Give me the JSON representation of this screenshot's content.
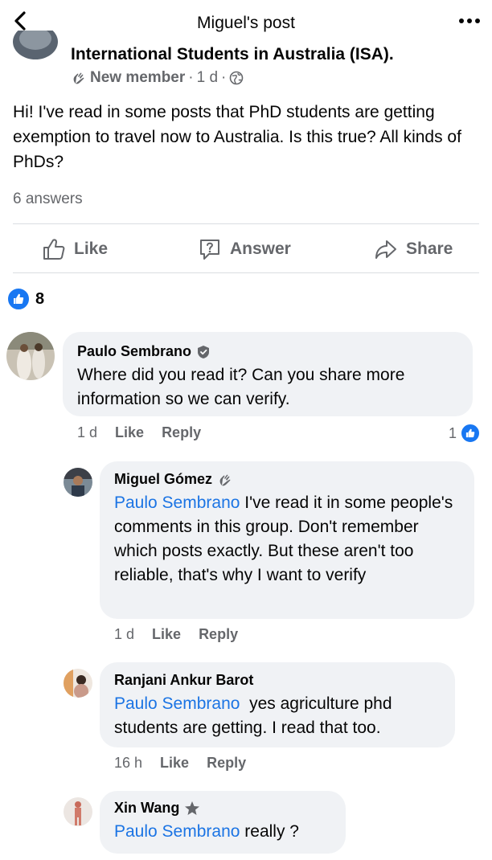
{
  "header": {
    "title": "Miguel's post"
  },
  "post": {
    "group_name": "International Students in Australia (ISA).",
    "member_badge": "New member",
    "time": "1 d",
    "separator": "·",
    "text": "Hi! I've read in some posts that PhD students are getting exemption to travel now to Australia. Is this true? All kinds of PhDs?",
    "answers_count": "6 answers",
    "actions": {
      "like": "Like",
      "answer": "Answer",
      "share": "Share"
    },
    "reaction_count": "8"
  },
  "comments": [
    {
      "author": "Paulo Sembrano",
      "text": "Where did you read it? Can you share more information so we can verify.",
      "time": "1 d",
      "like": "Like",
      "reply": "Reply",
      "reactions": "1"
    },
    {
      "author": "Miguel Gómez",
      "mention": "Paulo Sembrano",
      "text": "I've read it in some people's comments in this group. Don't remember which posts exactly. But these aren't too reliable, that's why I want to verify",
      "time": "1 d",
      "like": "Like",
      "reply": "Reply"
    },
    {
      "author": "Ranjani Ankur Barot",
      "mention": "Paulo Sembrano",
      "text": "yes agriculture phd students are getting. I read that too.",
      "time": "16 h",
      "like": "Like",
      "reply": "Reply"
    },
    {
      "author": "Xin Wang",
      "mention": "Paulo Sembrano",
      "text": "really ?"
    }
  ],
  "colors": {
    "accent": "#1877f2",
    "mention": "#1b74e4",
    "muted": "#65676b",
    "bubble": "#f0f2f5"
  },
  "icons": [
    "back-arrow-icon",
    "more-icon",
    "wave-icon",
    "globe-icon",
    "thumbs-up-icon",
    "question-icon",
    "share-arrow-icon",
    "verified-shield-icon",
    "star-badge-icon"
  ]
}
